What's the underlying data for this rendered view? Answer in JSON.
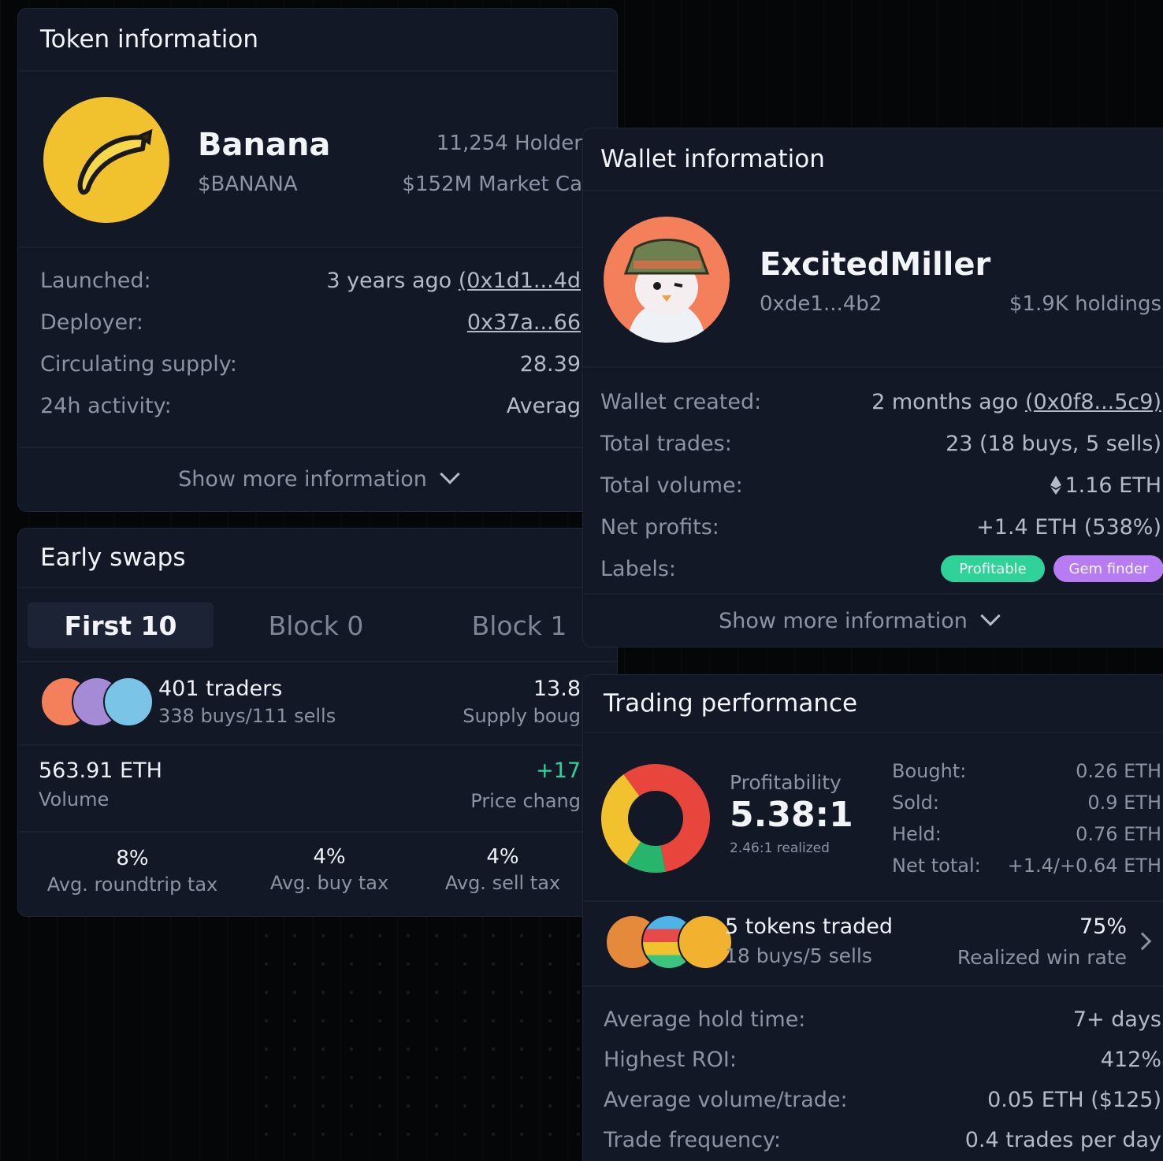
{
  "token": {
    "header": "Token information",
    "name": "Banana",
    "symbol": "$BANANA",
    "holders": "11,254 Holder",
    "market_cap": "$152M Market Ca",
    "rows": [
      {
        "label": "Launched:",
        "value_prefix": "3 years ago ",
        "value_link": "(0x1d1...4d"
      },
      {
        "label": "Deployer:",
        "value_prefix": "",
        "value_link": "0x37a...66"
      },
      {
        "label": "Circulating supply:",
        "value_prefix": "28.39",
        "value_link": ""
      },
      {
        "label": "24h activity:",
        "value_prefix": "Averag",
        "value_link": ""
      }
    ],
    "show_more": "Show more information"
  },
  "swaps": {
    "header": "Early swaps",
    "tabs": [
      "First 10",
      "Block 0",
      "Block 1"
    ],
    "traders_title": "401 traders",
    "traders_sub": "338 buys/111 sells",
    "supply_value": "13.8",
    "supply_label": "Supply boug",
    "volume_value": "563.91 ETH",
    "volume_label": "Volume",
    "price_change_value": "+17",
    "price_change_label": "Price chang",
    "taxes": [
      {
        "value": "8%",
        "label": "Avg. roundtrip tax"
      },
      {
        "value": "4%",
        "label": "Avg. buy tax"
      },
      {
        "value": "4%",
        "label": "Avg. sell tax"
      }
    ]
  },
  "wallet": {
    "header": "Wallet information",
    "name": "ExcitedMiller",
    "address": "0xde1...4b2",
    "holdings": "$1.9K holdings",
    "rows": [
      {
        "label": "Wallet created:",
        "value_prefix": "2 months ago ",
        "value_link": "(0x0f8...5c9)"
      },
      {
        "label": "Total trades:",
        "value_prefix": "23 (18 buys, 5 sells)",
        "value_link": ""
      },
      {
        "label": "Total volume:",
        "value_prefix": "1.16 ETH",
        "value_link": ""
      },
      {
        "label": "Net profits:",
        "value_prefix": "+1.4 ETH (538%)",
        "value_link": ""
      }
    ],
    "labels_label": "Labels:",
    "badges": [
      {
        "text": "Profitable",
        "color": "#2fd39a"
      },
      {
        "text": "Gem finder",
        "color": "#b77cf2"
      }
    ],
    "show_more": "Show more information"
  },
  "trading": {
    "header": "Trading performance",
    "profitability_label": "Profitability",
    "ratio": "5.38:1",
    "realized": "2.46:1 realized",
    "donut": [
      {
        "segment": "red",
        "value": 0.57,
        "color": "#e8453c"
      },
      {
        "segment": "green",
        "value": 0.12,
        "color": "#27b46b"
      },
      {
        "segment": "yellow",
        "value": 0.31,
        "color": "#f2c12e"
      }
    ],
    "stats": [
      {
        "label": "Bought:",
        "value": "0.26 ETH"
      },
      {
        "label": "Sold:",
        "value": "0.9 ETH"
      },
      {
        "label": "Held:",
        "value": "0.76 ETH"
      },
      {
        "label": "Net total:",
        "value": "+1.4/+0.64 ETH"
      }
    ],
    "tokens_title": "5 tokens traded",
    "tokens_sub": "18 buys/5 sells",
    "win_rate": "75%",
    "win_rate_label": "Realized win rate",
    "rows": [
      {
        "label": "Average hold time:",
        "value": "7+ days"
      },
      {
        "label": "Highest ROI:",
        "value": "412%"
      },
      {
        "label": "Average volume/trade:",
        "value": "0.05 ETH ($125)"
      },
      {
        "label": "Trade frequency:",
        "value": "0.4 trades per day"
      }
    ]
  }
}
